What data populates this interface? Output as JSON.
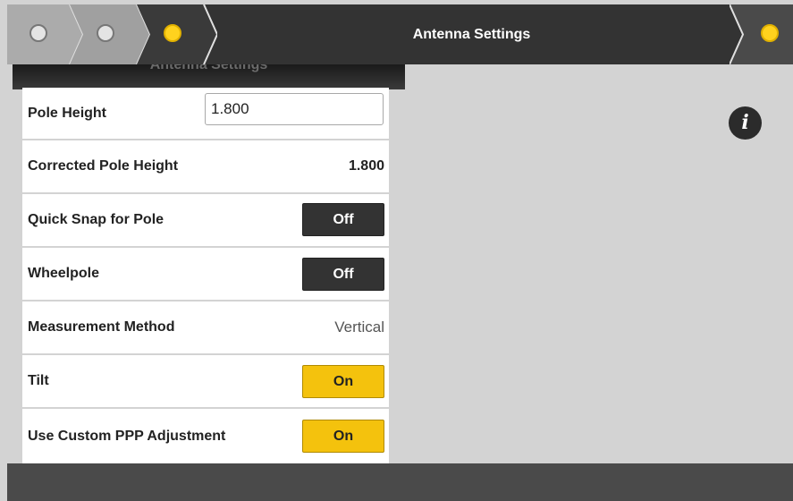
{
  "header": {
    "title": "Antenna Settings"
  },
  "panel": {
    "heading": "Antenna Settings"
  },
  "rows": {
    "pole_height": {
      "label": "Pole Height",
      "value": "1.800"
    },
    "corrected_pole_height": {
      "label": "Corrected Pole Height",
      "value": "1.800"
    },
    "quick_snap": {
      "label": "Quick Snap for Pole",
      "value": "Off"
    },
    "wheelpole": {
      "label": "Wheelpole",
      "value": "Off"
    },
    "measurement_method": {
      "label": "Measurement Method",
      "value": "Vertical"
    },
    "tilt": {
      "label": "Tilt",
      "value": "On"
    },
    "custom_ppp": {
      "label": "Use Custom PPP Adjustment",
      "value": "On"
    }
  },
  "icons": {
    "info": "info-icon",
    "info_glyph": "i"
  },
  "colors": {
    "accent": "#f4c20d",
    "topbar": "#333333",
    "background": "#d3d3d3"
  }
}
